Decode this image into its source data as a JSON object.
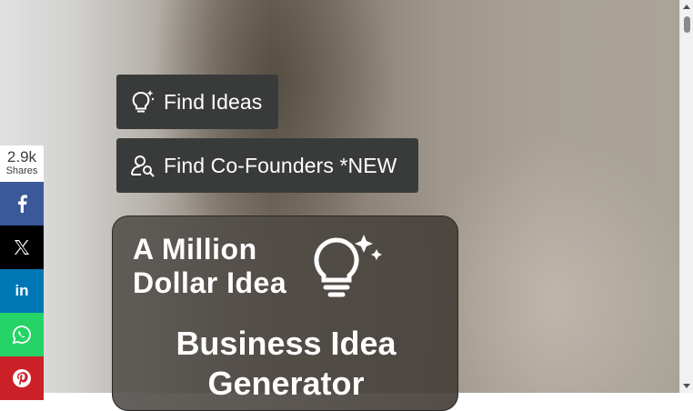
{
  "nav": {
    "find_ideas": {
      "label": "Find Ideas",
      "icon": "lightbulb-sparkle-icon"
    },
    "find_cofounders": {
      "label": "Find Co-Founders *NEW",
      "icon": "user-search-icon"
    }
  },
  "card": {
    "logo_line1": "A Million",
    "logo_line2": "Dollar Idea",
    "logo_icon": "lightbulb-sparkle-icon",
    "title": "Business Idea Generator"
  },
  "share": {
    "count": "2.9k",
    "count_label": "Shares",
    "buttons": [
      {
        "network": "facebook",
        "icon": "facebook-icon",
        "color": "#3b5998"
      },
      {
        "network": "x",
        "icon": "x-icon",
        "color": "#000000"
      },
      {
        "network": "linkedin",
        "icon": "linkedin-icon",
        "color": "#0077b5"
      },
      {
        "network": "whatsapp",
        "icon": "whatsapp-icon",
        "color": "#25d366"
      },
      {
        "network": "pinterest",
        "icon": "pinterest-icon",
        "color": "#cb2027"
      }
    ]
  },
  "colors": {
    "button_bg": "#393b3a",
    "card_bg": "#54504b"
  }
}
